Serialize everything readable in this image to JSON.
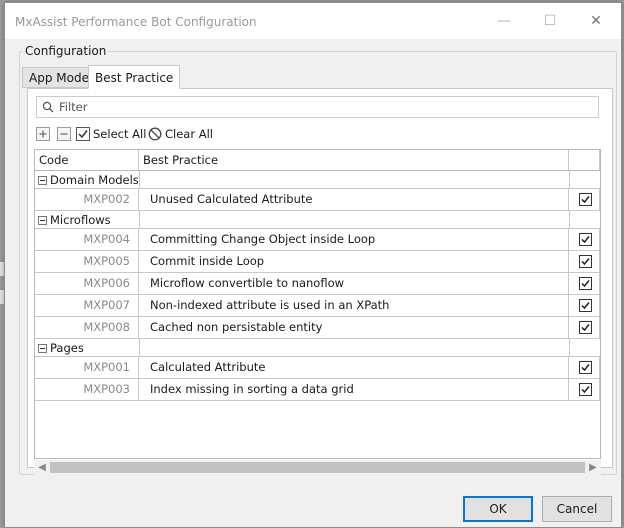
{
  "window": {
    "title": "MxAssist Performance Bot Configuration"
  },
  "groupbox": {
    "label": "Configuration"
  },
  "tabs": [
    {
      "label": "App Model",
      "active": false
    },
    {
      "label": "Best Practice",
      "active": true
    }
  ],
  "filter": {
    "placeholder": "Filter",
    "value": ""
  },
  "toolbar": {
    "select_all": "Select All",
    "clear_all": "Clear All"
  },
  "grid": {
    "columns": [
      "Code",
      "Best Practice"
    ],
    "groups": [
      {
        "name": "Domain Models",
        "rows": [
          {
            "code": "MXP002",
            "name": "Unused Calculated Attribute",
            "checked": true
          }
        ]
      },
      {
        "name": "Microflows",
        "rows": [
          {
            "code": "MXP004",
            "name": "Committing Change Object inside Loop",
            "checked": true
          },
          {
            "code": "MXP005",
            "name": "Commit inside Loop",
            "checked": true
          },
          {
            "code": "MXP006",
            "name": "Microflow convertible to nanoflow",
            "checked": true
          },
          {
            "code": "MXP007",
            "name": "Non-indexed attribute is used in an XPath",
            "checked": true
          },
          {
            "code": "MXP008",
            "name": "Cached non persistable entity",
            "checked": true
          }
        ]
      },
      {
        "name": "Pages",
        "rows": [
          {
            "code": "MXP001",
            "name": "Calculated Attribute",
            "checked": true
          },
          {
            "code": "MXP003",
            "name": "Index missing in sorting a data grid",
            "checked": true
          }
        ]
      }
    ]
  },
  "buttons": {
    "ok": "OK",
    "cancel": "Cancel"
  },
  "colors": {
    "accent": "#0078d7",
    "code_text": "#8a8a8a"
  }
}
